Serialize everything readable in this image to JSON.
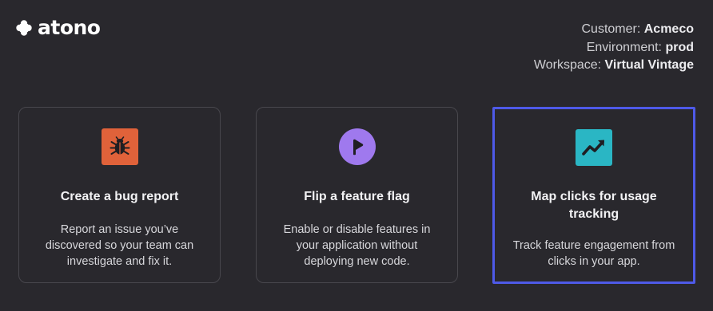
{
  "brand": {
    "name": "atono"
  },
  "context": {
    "customer_label": "Customer:",
    "customer_value": "Acmeco",
    "environment_label": "Environment:",
    "environment_value": "prod",
    "workspace_label": "Workspace:",
    "workspace_value": "Virtual Vintage"
  },
  "cards": [
    {
      "icon": "bug-icon",
      "icon_color": "#e0623a",
      "title": "Create a bug report",
      "description": "Report an issue you’ve discovered so your team can investigate and fix it."
    },
    {
      "icon": "feature-flag-icon",
      "icon_color": "#9f79ee",
      "title": "Flip a feature flag",
      "description": "Enable or disable features in your application without deploying new code."
    },
    {
      "icon": "trend-chart-icon",
      "icon_color": "#2ab6c4",
      "title": "Map clicks for usage tracking",
      "description": "Track feature engagement from clicks in your app.",
      "selected": true
    }
  ],
  "colors": {
    "background": "#29282d",
    "card_border": "#48474d",
    "selected_border": "#4e5ae8"
  }
}
